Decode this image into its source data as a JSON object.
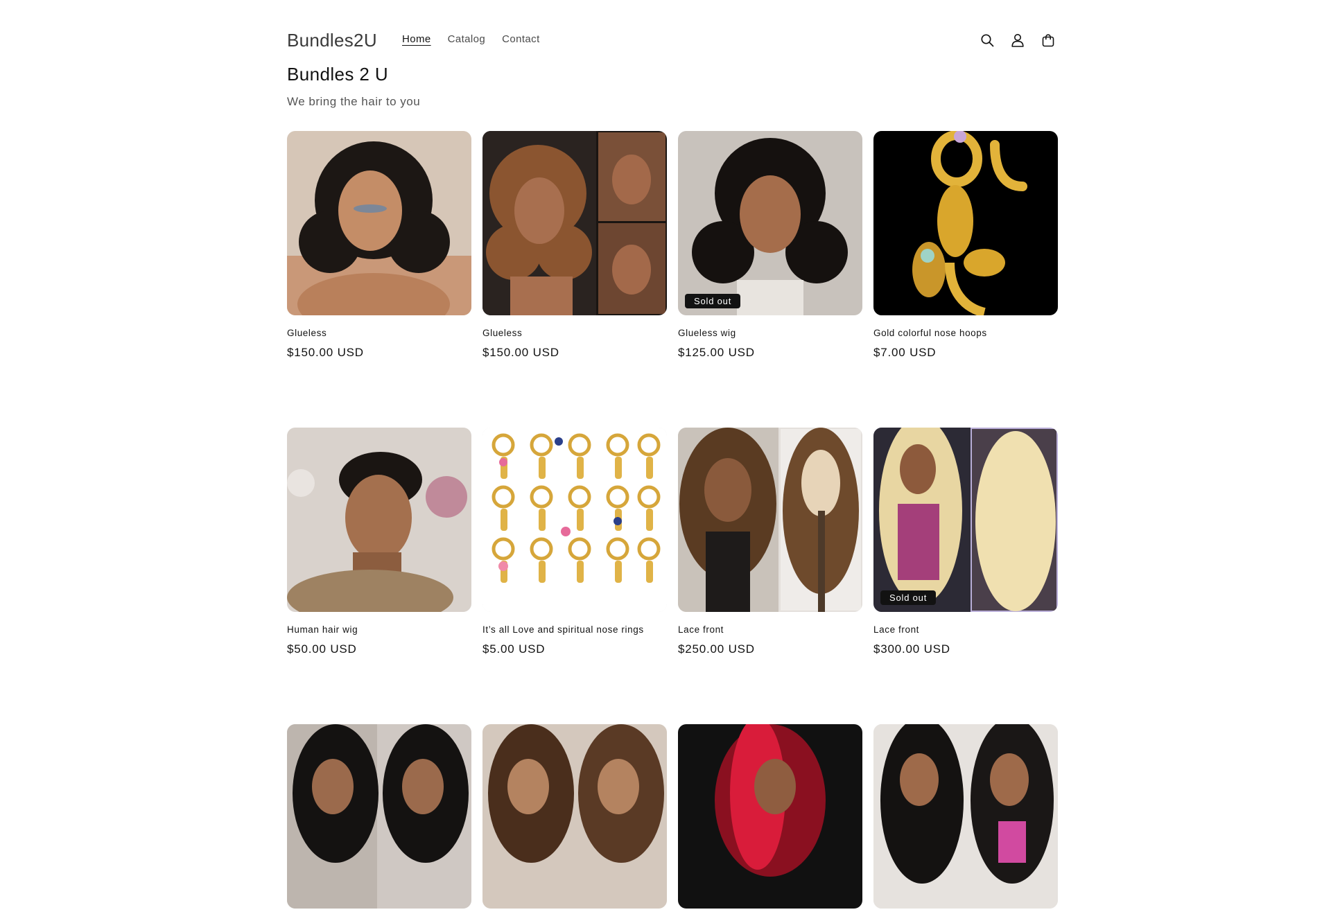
{
  "header": {
    "logo": "Bundles2U",
    "nav": [
      {
        "label": "Home",
        "active": true
      },
      {
        "label": "Catalog",
        "active": false
      },
      {
        "label": "Contact",
        "active": false
      }
    ],
    "icons": [
      "search-icon",
      "account-icon",
      "cart-icon"
    ]
  },
  "intro": {
    "title": "Bundles 2 U",
    "subtitle": "We bring the hair to you"
  },
  "products": [
    {
      "title": "Glueless",
      "price": "$150.00 USD",
      "badge": ""
    },
    {
      "title": "Glueless",
      "price": "$150.00 USD",
      "badge": ""
    },
    {
      "title": "Glueless wig",
      "price": "$125.00 USD",
      "badge": "Sold out"
    },
    {
      "title": "Gold colorful nose hoops",
      "price": "$7.00 USD",
      "badge": ""
    },
    {
      "title": "Human hair wig",
      "price": "$50.00 USD",
      "badge": ""
    },
    {
      "title": "It’s all Love and spiritual nose rings",
      "price": "$5.00 USD",
      "badge": ""
    },
    {
      "title": "Lace front",
      "price": "$250.00 USD",
      "badge": ""
    },
    {
      "title": "Lace front",
      "price": "$300.00 USD",
      "badge": "Sold out"
    },
    {
      "title": "",
      "price": "",
      "badge": ""
    },
    {
      "title": "",
      "price": "",
      "badge": ""
    },
    {
      "title": "",
      "price": "",
      "badge": ""
    },
    {
      "title": "",
      "price": "",
      "badge": ""
    }
  ]
}
